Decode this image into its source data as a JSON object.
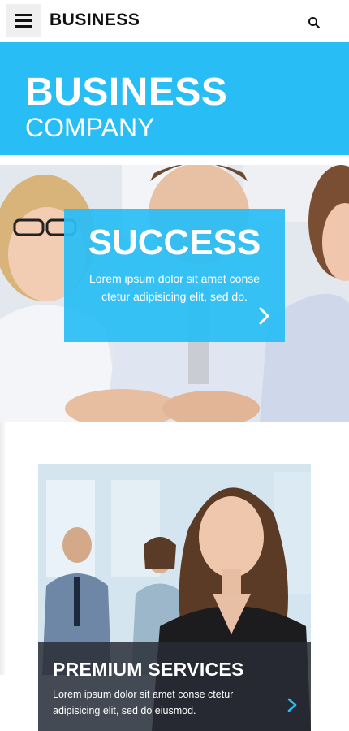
{
  "header": {
    "brand": "BUSINESS",
    "menu_icon": "hamburger-menu-icon",
    "search_icon": "search-icon"
  },
  "title_band": {
    "line1": "BUSINESS",
    "line2": "COMPANY",
    "color": "#29bdf5"
  },
  "hero": {
    "title": "SUCCESS",
    "text": "Lorem ipsum dolor sit amet conse ctetur adipisicing elit, sed do.",
    "arrow_icon": "chevron-right-icon"
  },
  "services_card": {
    "title": "PREMIUM SERVICES",
    "text": "Lorem ipsum dolor sit amet conse ctetur adipisicing elit, sed do eiusmod.",
    "arrow_icon": "chevron-right-icon",
    "arrow_color": "#29bdf5"
  }
}
